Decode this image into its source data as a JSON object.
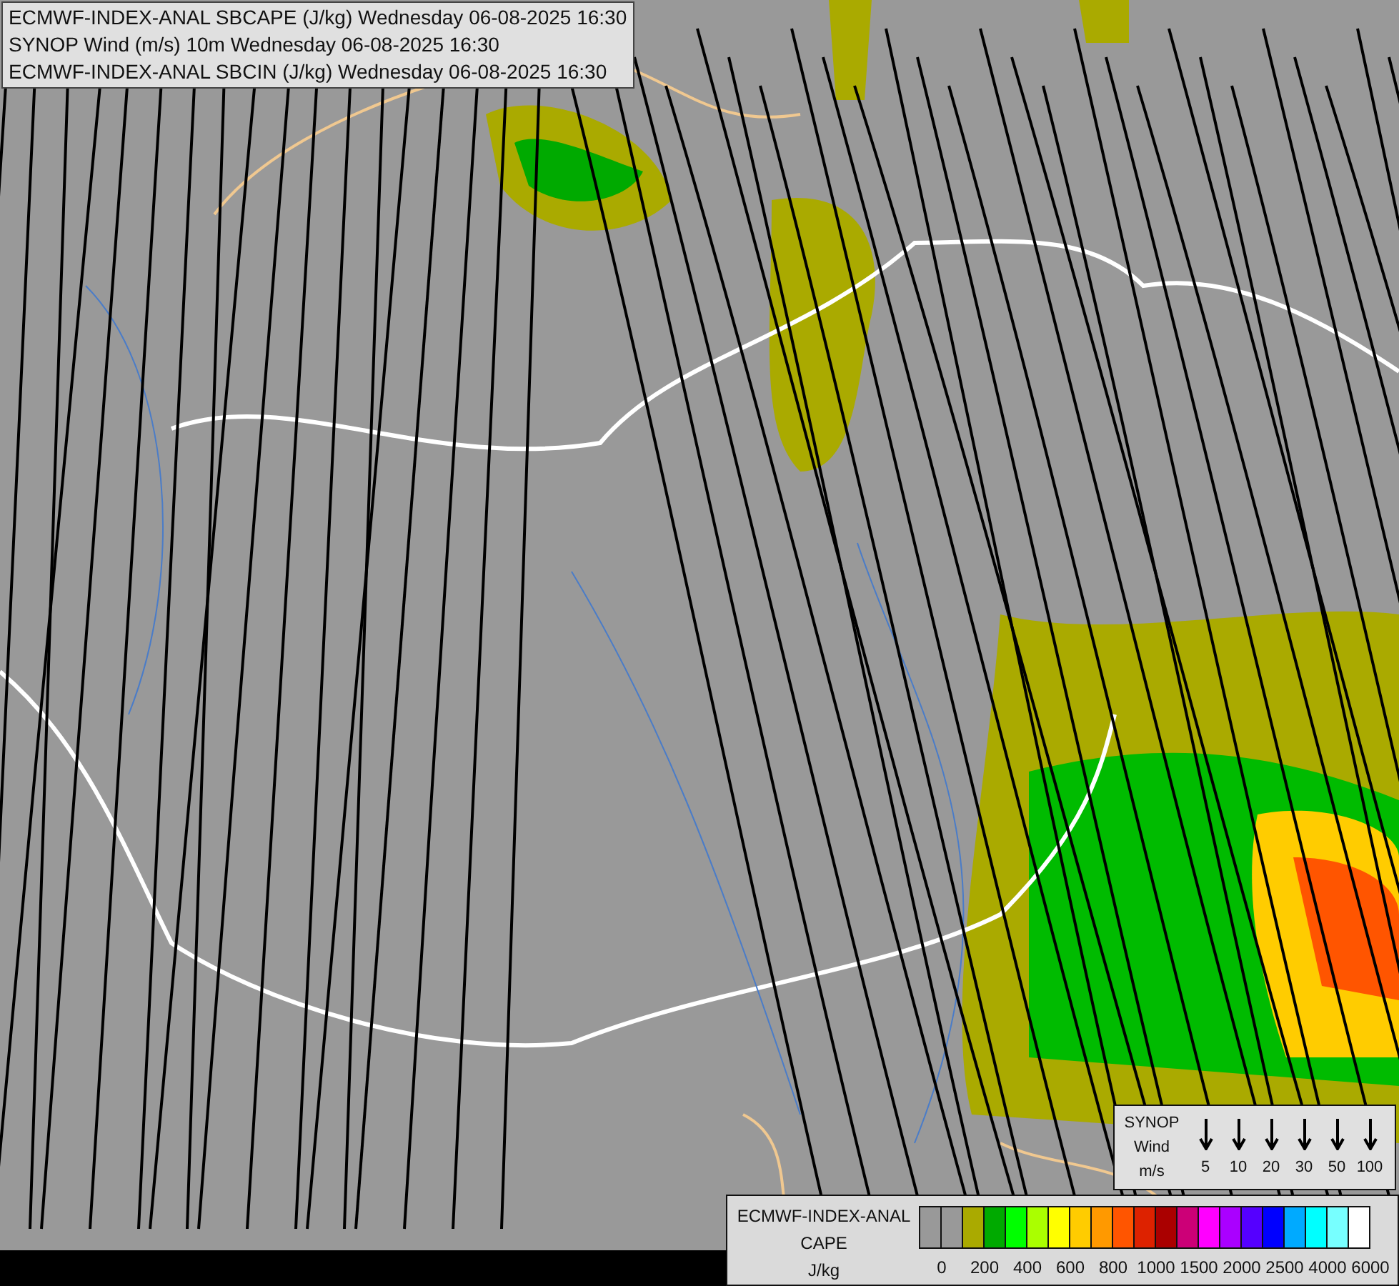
{
  "title_lines": [
    "ECMWF-INDEX-ANAL SBCAPE (J/kg) Wednesday 06-08-2025 16:30",
    "SYNOP Wind (m/s) 10m Wednesday 06-08-2025 16:30",
    "ECMWF-INDEX-ANAL SBCIN (J/kg) Wednesday 06-08-2025 16:30"
  ],
  "wind_legend": {
    "title_lines": [
      "SYNOP",
      "Wind",
      "m/s"
    ],
    "speeds": [
      "5",
      "10",
      "20",
      "30",
      "50",
      "100"
    ]
  },
  "cape_legend": {
    "title_lines": [
      "ECMWF-INDEX-ANAL",
      "CAPE",
      "J/kg"
    ],
    "swatches": [
      {
        "color": "#999999"
      },
      {
        "color": "#999999"
      },
      {
        "color": "#aaaa00"
      },
      {
        "color": "#00aa00"
      },
      {
        "color": "#00ff00"
      },
      {
        "color": "#aaff00"
      },
      {
        "color": "#ffff00"
      },
      {
        "color": "#ffcc00"
      },
      {
        "color": "#ff9900"
      },
      {
        "color": "#ff5500"
      },
      {
        "color": "#dd2200"
      },
      {
        "color": "#aa0000"
      },
      {
        "color": "#cc0077"
      },
      {
        "color": "#ff00ff"
      },
      {
        "color": "#aa00ff"
      },
      {
        "color": "#5500ff"
      },
      {
        "color": "#0000ff"
      },
      {
        "color": "#00aaff"
      },
      {
        "color": "#00ffff"
      },
      {
        "color": "#77ffff"
      },
      {
        "color": "#ffffff"
      }
    ],
    "ticks": [
      "0",
      "200",
      "400",
      "600",
      "800",
      "1000",
      "1500",
      "2000",
      "2500",
      "4000",
      "6000"
    ]
  }
}
